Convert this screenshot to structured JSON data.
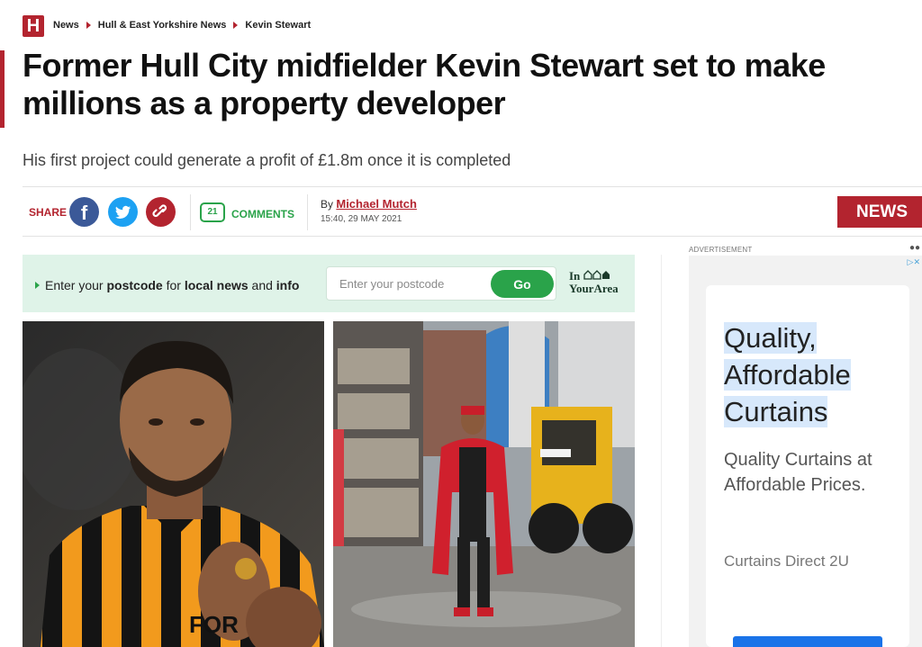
{
  "site": {
    "logo_letter": "H"
  },
  "breadcrumb": [
    "News",
    "Hull & East Yorkshire News",
    "Kevin Stewart"
  ],
  "article": {
    "headline": "Former Hull City midfielder Kevin Stewart set to make millions as a property developer",
    "standfirst": "His first project could generate a profit of £1.8m once it is completed",
    "share_label": "SHARE",
    "comment_count": "21",
    "comments_label": "COMMENTS",
    "by_prefix": "By",
    "author": "Michael Mutch",
    "published": "15:40, 29 MAY 2021",
    "section_tag": "NEWS"
  },
  "postcode_widget": {
    "text_prefix": "Enter your",
    "text_bold1": "postcode",
    "text_mid": "for",
    "text_bold2": "local news",
    "text_and": "and",
    "text_bold3": "info",
    "placeholder": "Enter your postcode",
    "go_label": "Go",
    "brand_line1": "In",
    "brand_line2": "YourArea"
  },
  "ad": {
    "label": "ADVERTISEMENT",
    "headline_line1": "Quality,",
    "headline_line2": "Affordable",
    "headline_line3": "Curtains",
    "sub": "Quality Curtains at Affordable Prices.",
    "advertiser": "Curtains Direct 2U"
  },
  "colors": {
    "brand_red": "#b3242f",
    "green": "#2aa34a",
    "facebook": "#3b5998",
    "twitter": "#1da1f2"
  },
  "photos": [
    {
      "icon": "footballer-photo"
    },
    {
      "icon": "building-site-photo"
    }
  ]
}
